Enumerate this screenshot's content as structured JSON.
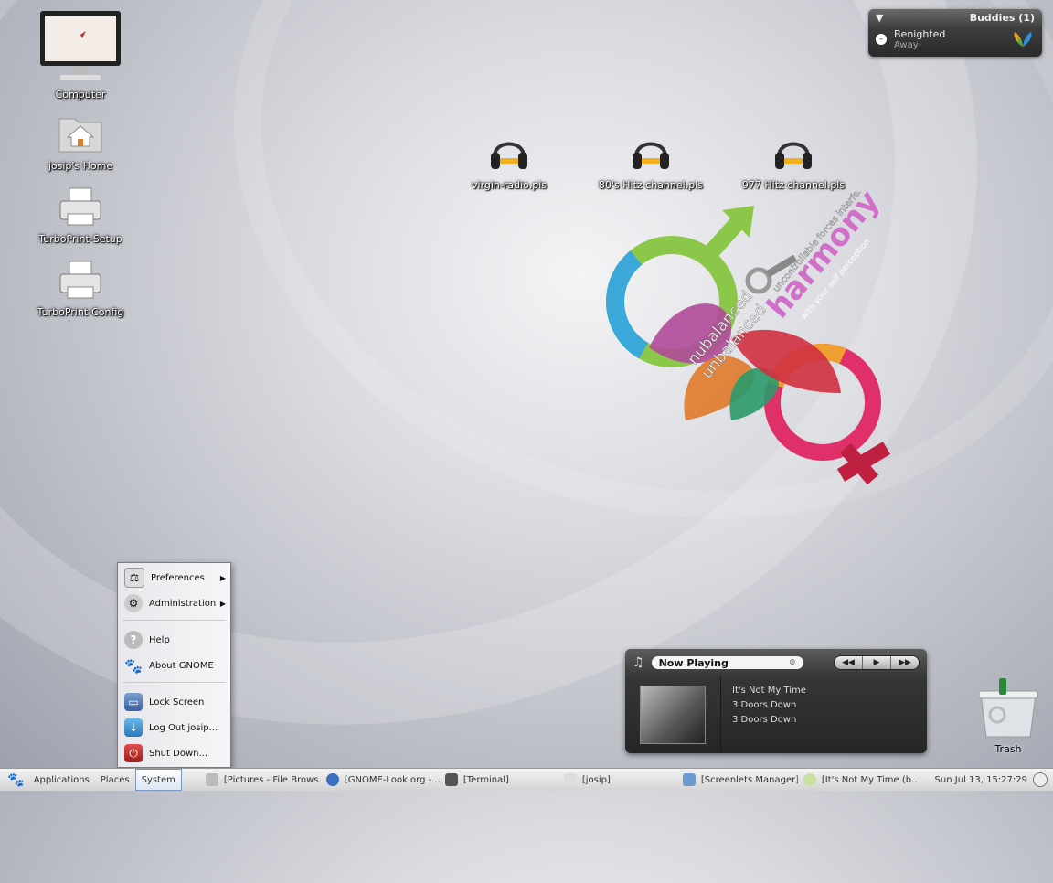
{
  "desktop": {
    "icons": [
      {
        "label": "Computer"
      },
      {
        "label": "josip's Home"
      },
      {
        "label": "TurboPrint-Setup"
      },
      {
        "label": "TurboPrint-Config"
      },
      {
        "label": "virgin-radio.pls"
      },
      {
        "label": "80's Hitz channel.pls"
      },
      {
        "label": "977 Hitz channel.pls"
      },
      {
        "label": "Trash"
      }
    ],
    "wallpaper": {
      "lines": [
        "nubalanced",
        "unbalanced",
        "uncontrollable forces interferes",
        "harmony",
        "with your self perception"
      ]
    }
  },
  "buddies": {
    "title": "Buddies (1)",
    "buddy_name": "Benighted",
    "buddy_status": "Away"
  },
  "music": {
    "now_playing_label": "Now Playing",
    "track": "It's Not My Time",
    "artist": "3 Doors Down",
    "album": "3 Doors Down",
    "buttons": {
      "prev": "◀◀",
      "play": "▶",
      "next": "▶▶"
    }
  },
  "system_menu": {
    "items": [
      {
        "label": "Preferences",
        "icon": "preferences-icon",
        "submenu": true
      },
      {
        "label": "Administration",
        "icon": "administration-icon",
        "submenu": true
      },
      {
        "label": "Help",
        "icon": "help-icon",
        "submenu": false
      },
      {
        "label": "About GNOME",
        "icon": "gnome-icon",
        "submenu": false
      },
      {
        "label": "Lock Screen",
        "icon": "lock-icon",
        "submenu": false
      },
      {
        "label": "Log Out josip...",
        "icon": "logout-icon",
        "submenu": false
      },
      {
        "label": "Shut Down...",
        "icon": "shutdown-icon",
        "submenu": false
      }
    ]
  },
  "taskbar": {
    "applications": "Applications",
    "places": "Places",
    "system": "System",
    "tasks": [
      {
        "label": "[Pictures - File Brows...",
        "icon": "folder-icon"
      },
      {
        "label": "[GNOME-Look.org - ...",
        "icon": "browser-icon"
      },
      {
        "label": "[Terminal]",
        "icon": "terminal-icon"
      },
      {
        "label": "[josip]",
        "icon": "window-icon"
      },
      {
        "label": "[Screenlets Manager]",
        "icon": "screenlets-icon"
      },
      {
        "label": "[It's Not My Time (b...",
        "icon": "music-icon"
      }
    ],
    "clock": "Sun Jul 13, 15:27:29"
  }
}
